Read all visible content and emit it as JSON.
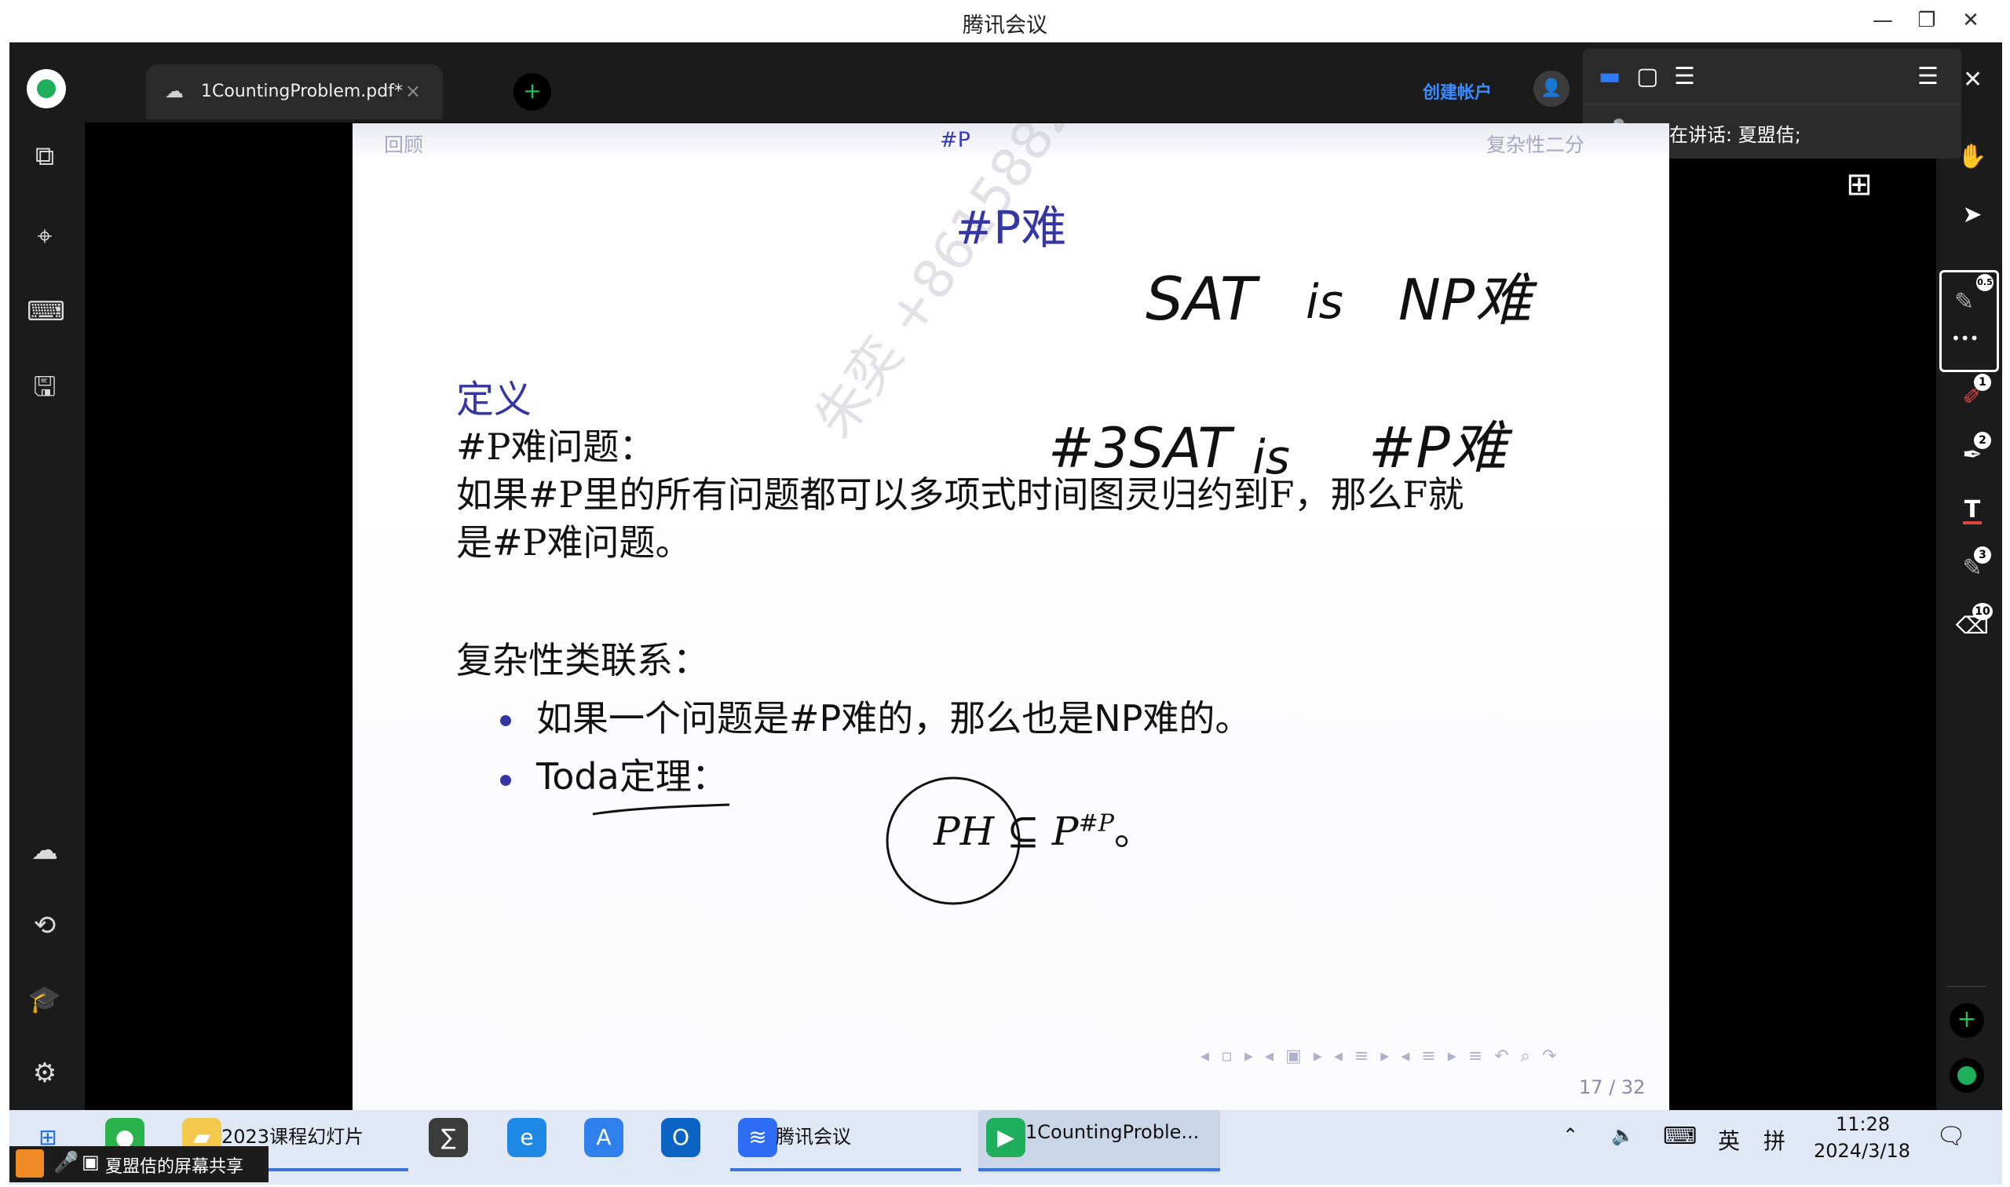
{
  "window": {
    "title": "腾讯会议",
    "minimize": "—",
    "restore": "❐",
    "close": "✕"
  },
  "app": {
    "tab": {
      "icon": "cloud-off-icon",
      "label": "1CountingProblem.pdf*",
      "close": "×"
    },
    "new_tab": "+",
    "create_account": "创建帐户",
    "left_icons": [
      "pages-icon",
      "binoculars-icon",
      "keyboard-icon",
      "save-icon",
      "cloud-icon",
      "hand-swap-icon",
      "graduation-icon",
      "settings-icon"
    ]
  },
  "speaker_panel": {
    "speaking_label": "正在讲话:",
    "speaker_name": "夏盟佶;",
    "close": "✕"
  },
  "slide": {
    "header": {
      "left": "回顾",
      "center": "#P",
      "right": "复杂性二分"
    },
    "title": "#P难",
    "definition_heading": "定义",
    "definition_term": "#P难问题：",
    "definition_line1": "如果#P里的所有问题都可以多项式时间图灵归约到F，那么F就",
    "definition_line2": "是#P难问题。",
    "relation_heading": "复杂性类联系：",
    "bullet1": "如果一个问题是#P难的，那么也是NP难的。",
    "bullet2": "Toda定理：",
    "formula": "PH ⊆ P",
    "formula_sup": "#P",
    "formula_end": "。",
    "watermark": "朱奕 +8615882​38807",
    "page_number": "17 / 32",
    "beamer_nav": "◂ ▫ ▸  ◂ ▣ ▸  ◂ ≡ ▸  ◂ ≡ ▸    ≡    ↶ ⌕ ↷",
    "ink": {
      "line1": [
        "SAT",
        "is",
        "NP难"
      ],
      "line2": [
        "#3SAT",
        "is",
        "#P难"
      ]
    }
  },
  "right_toolbar": {
    "pen_badge": "0.5",
    "more": "•••",
    "badges": [
      "1",
      "2",
      "3",
      "10"
    ]
  },
  "taskbar": {
    "items": [
      {
        "label": "2023课程幻灯片"
      },
      {
        "label": "腾讯会议"
      },
      {
        "label": "1CountingProble..."
      }
    ],
    "share_banner": "夏盟佶的屏幕共享",
    "ime_lang": "英",
    "ime_mode": "拼",
    "time": "11:28",
    "date": "2024/3/18"
  }
}
